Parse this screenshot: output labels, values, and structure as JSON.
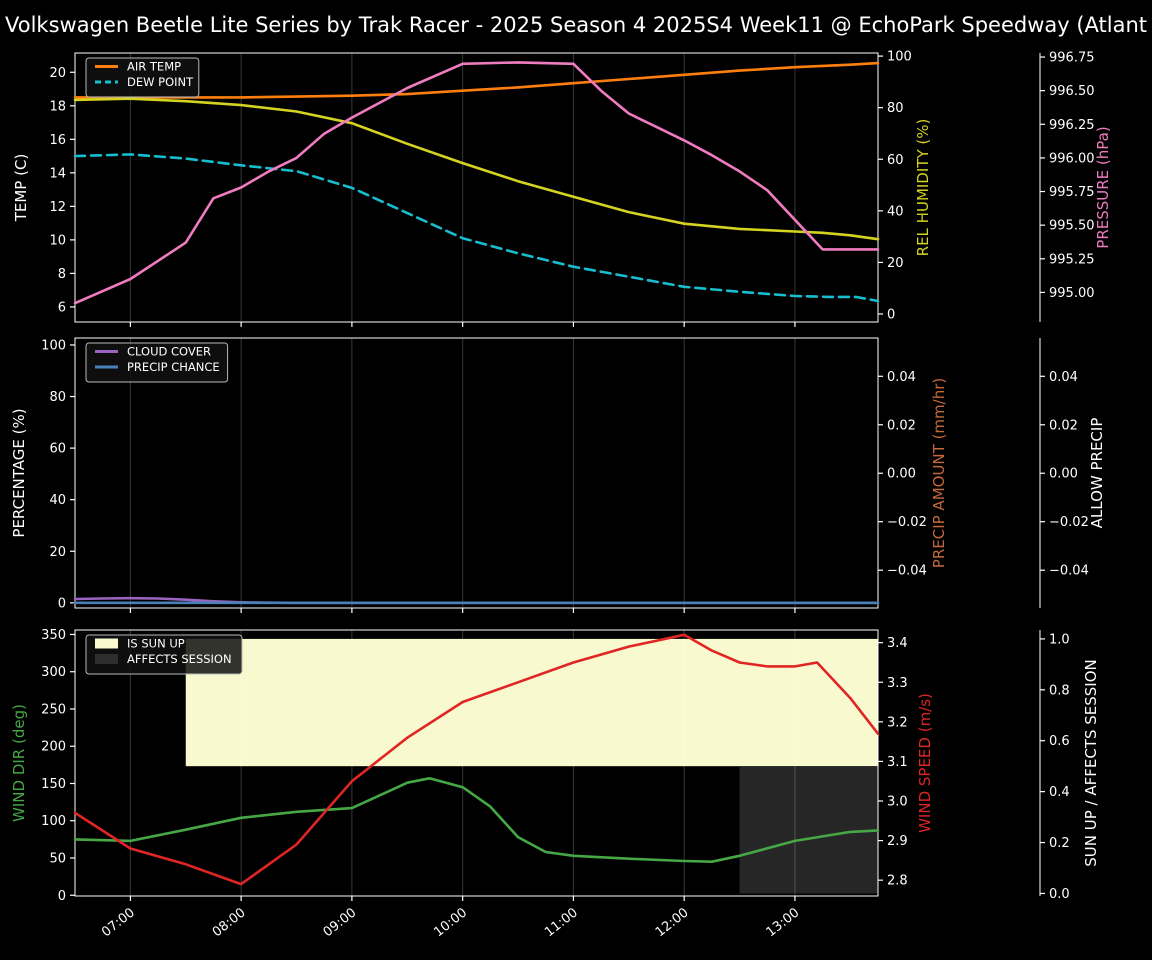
{
  "title": "Volkswagen Beetle Lite Series by Trak Racer - 2025 Season 4 2025S4 Week11 @ EchoPark Speedway (Atlant",
  "colors": {
    "background": "#000000",
    "text": "#ffffff",
    "grid": "rgba(255,255,255,0.22)",
    "air_temp": "#ff7f0e",
    "dew_point": "#17becf",
    "rel_humidity": "#d4d321",
    "pressure": "#ef7bc0",
    "cloud_cover": "#9c63c0",
    "precip_chance": "#4a80b8",
    "precip_amount": "#c4693b",
    "wind_dir": "#46a746",
    "wind_speed": "#e02525",
    "sun_up_fill": "#f9f9cf",
    "affects_session_fill": "#262626"
  },
  "chart_data": [
    {
      "name": "temp-humidity-pressure-chart",
      "type": "line",
      "x_axis": {
        "lim": [
          6.5,
          13.75
        ],
        "tick_values": [
          7,
          8,
          9,
          10,
          11,
          12,
          13
        ],
        "tick_labels": [
          "07:00",
          "08:00",
          "09:00",
          "10:00",
          "11:00",
          "12:00",
          "13:00"
        ],
        "show_labels": false
      },
      "axes": {
        "left": {
          "label": "TEMP (C)",
          "color": "#ffffff",
          "ticks": [
            6,
            8,
            10,
            12,
            14,
            16,
            18,
            20
          ],
          "lim": [
            5.1,
            21.15
          ],
          "decimals": 0
        },
        "right": {
          "label": "REL HUMIDITY (%)",
          "color": "#d4d321",
          "ticks": [
            0,
            20,
            40,
            60,
            80,
            100
          ],
          "lim": [
            -3.1,
            101.2
          ],
          "decimals": 0
        },
        "far": {
          "label": "PRESSURE (hPa)",
          "color": "#ef7bc0",
          "ticks": [
            995.0,
            995.25,
            995.5,
            995.75,
            996.0,
            996.25,
            996.5,
            996.75
          ],
          "lim": [
            994.78,
            996.78
          ],
          "decimals": 2
        }
      },
      "series": [
        {
          "name": "air-temp",
          "label": "AIR TEMP",
          "color": "#ff7f0e",
          "axis": "left",
          "dash": false,
          "x": [
            6.5,
            7,
            7.5,
            8,
            8.5,
            9,
            9.5,
            10,
            10.5,
            11,
            11.5,
            12,
            12.5,
            13,
            13.5,
            13.75
          ],
          "y": [
            18.5,
            18.5,
            18.5,
            18.5,
            18.55,
            18.6,
            18.7,
            18.9,
            19.1,
            19.35,
            19.6,
            19.85,
            20.1,
            20.3,
            20.45,
            20.55
          ]
        },
        {
          "name": "dew-point",
          "label": "DEW POINT",
          "color": "#17becf",
          "axis": "left",
          "dash": true,
          "x": [
            6.5,
            7,
            7.5,
            8,
            8.5,
            9,
            9.5,
            10,
            10.5,
            11,
            11.5,
            12,
            12.5,
            13,
            13.3,
            13.55,
            13.75
          ],
          "y": [
            15.0,
            15.1,
            14.85,
            14.45,
            14.1,
            13.1,
            11.6,
            10.1,
            9.2,
            8.4,
            7.8,
            7.2,
            6.9,
            6.65,
            6.6,
            6.6,
            6.35
          ]
        },
        {
          "name": "rel-humidity",
          "color": "#d4d321",
          "axis": "right",
          "dash": false,
          "x": [
            6.5,
            7,
            7.5,
            8,
            8.5,
            9,
            9.5,
            10,
            10.5,
            11,
            11.5,
            12,
            12.5,
            13,
            13.25,
            13.5,
            13.75
          ],
          "y": [
            83,
            83.5,
            82.5,
            81,
            78.5,
            74,
            66,
            58.5,
            51.5,
            45.5,
            39.5,
            35,
            33,
            32,
            31.5,
            30.5,
            29
          ]
        },
        {
          "name": "pressure",
          "color": "#ef7bc0",
          "axis": "far",
          "dash": false,
          "x": [
            6.5,
            7,
            7.5,
            7.75,
            8,
            8.25,
            8.5,
            8.75,
            9,
            9.5,
            10,
            10.5,
            11,
            11.25,
            11.5,
            12,
            12.25,
            12.5,
            12.75,
            13,
            13.25,
            13.75
          ],
          "y": [
            994.92,
            995.1,
            995.37,
            995.7,
            995.78,
            995.9,
            996.0,
            996.18,
            996.3,
            996.52,
            996.7,
            996.71,
            996.7,
            996.5,
            996.33,
            996.13,
            996.02,
            995.9,
            995.76,
            995.54,
            995.32,
            995.32
          ]
        }
      ],
      "legend": {
        "entries": [
          {
            "label": "AIR TEMP",
            "color": "#ff7f0e",
            "swatch": "line"
          },
          {
            "label": "DEW POINT",
            "color": "#17becf",
            "swatch": "dash"
          }
        ]
      }
    },
    {
      "name": "cloud-precip-chart",
      "type": "line",
      "x_axis": {
        "lim": [
          6.5,
          13.75
        ],
        "tick_values": [
          7,
          8,
          9,
          10,
          11,
          12,
          13
        ],
        "tick_labels": [
          "07:00",
          "08:00",
          "09:00",
          "10:00",
          "11:00",
          "12:00",
          "13:00"
        ],
        "show_labels": false
      },
      "axes": {
        "left": {
          "label": "PERCENTAGE (%)",
          "color": "#ffffff",
          "ticks": [
            0,
            20,
            40,
            60,
            80,
            100
          ],
          "lim": [
            -2,
            102.7
          ],
          "decimals": 0
        },
        "right": {
          "label": "PRECIP AMOUNT (mm/hr)",
          "color": "#c4693b",
          "ticks": [
            0.04,
            0.02,
            0.0,
            -0.02,
            -0.04
          ],
          "lim": [
            -0.0556,
            0.0558
          ],
          "decimals": 2
        },
        "far": {
          "label": "ALLOW PRECIP",
          "color": "#ffffff",
          "ticks": [
            0.04,
            0.02,
            0.0,
            -0.02,
            -0.04
          ],
          "lim": [
            -0.0556,
            0.0558
          ],
          "decimals": 2
        }
      },
      "series": [
        {
          "name": "cloud-cover",
          "label": "CLOUD COVER",
          "color": "#9c63c0",
          "axis": "left",
          "dash": false,
          "x": [
            6.5,
            6.75,
            7,
            7.25,
            7.5,
            7.75,
            8,
            8.25,
            8.5,
            13.75
          ],
          "y": [
            1.5,
            1.7,
            1.8,
            1.7,
            1.2,
            0.6,
            0.2,
            0.05,
            0,
            0
          ]
        },
        {
          "name": "precip-chance",
          "label": "PRECIP CHANCE",
          "color": "#4a80b8",
          "axis": "left",
          "dash": false,
          "x": [
            6.5,
            13.75
          ],
          "y": [
            0,
            0
          ]
        }
      ],
      "legend": {
        "entries": [
          {
            "label": "CLOUD COVER",
            "color": "#9c63c0",
            "swatch": "line"
          },
          {
            "label": "PRECIP CHANCE",
            "color": "#4a80b8",
            "swatch": "line"
          }
        ]
      }
    },
    {
      "name": "wind-sun-chart",
      "type": "line",
      "x_axis": {
        "lim": [
          6.5,
          13.75
        ],
        "tick_values": [
          7,
          8,
          9,
          10,
          11,
          12,
          13
        ],
        "tick_labels": [
          "07:00",
          "08:00",
          "09:00",
          "10:00",
          "11:00",
          "12:00",
          "13:00"
        ],
        "show_labels": true
      },
      "axes": {
        "left": {
          "label": "WIND DIR (deg)",
          "color": "#46a746",
          "ticks": [
            0,
            50,
            100,
            150,
            200,
            250,
            300,
            350
          ],
          "lim": [
            -1,
            356
          ],
          "decimals": 0
        },
        "right": {
          "label": "WIND SPEED (m/s)",
          "color": "#e02525",
          "ticks": [
            2.8,
            2.9,
            3.0,
            3.1,
            3.2,
            3.3,
            3.4
          ],
          "lim": [
            2.76,
            3.432
          ],
          "decimals": 1
        },
        "far": {
          "label": "SUN UP / AFFECTS SESSION",
          "color": "#ffffff",
          "ticks": [
            0.0,
            0.2,
            0.4,
            0.6,
            0.8,
            1.0
          ],
          "lim": [
            -0.01,
            1.035
          ],
          "decimals": 1
        }
      },
      "regions": [
        {
          "name": "is-sun-up",
          "color": "#f9f9cf",
          "axis": "far",
          "x": [
            7.5,
            13.75
          ],
          "y": [
            0.5,
            1.0
          ]
        },
        {
          "name": "affects-session",
          "color": "#262626",
          "axis": "far",
          "x": [
            12.5,
            13.75
          ],
          "y": [
            0.0,
            0.5
          ]
        }
      ],
      "series": [
        {
          "name": "wind-dir",
          "color": "#46a746",
          "axis": "left",
          "dash": false,
          "x": [
            6.5,
            7,
            7.5,
            8,
            8.5,
            9,
            9.5,
            9.7,
            10,
            10.25,
            10.5,
            10.75,
            11,
            11.5,
            12,
            12.25,
            12.5,
            13,
            13.5,
            13.75
          ],
          "y": [
            75,
            73,
            88,
            104,
            112,
            117,
            151,
            157,
            145,
            119,
            78,
            58,
            53,
            49,
            46,
            45,
            53,
            73,
            85,
            87
          ]
        },
        {
          "name": "wind-speed",
          "color": "#e02525",
          "axis": "right",
          "dash": false,
          "x": [
            6.5,
            7,
            7.5,
            8,
            8.5,
            9,
            9.5,
            10,
            10.5,
            11,
            11.5,
            12,
            12.25,
            12.5,
            12.75,
            13,
            13.2,
            13.5,
            13.75
          ],
          "y": [
            2.97,
            2.88,
            2.84,
            2.79,
            2.89,
            3.05,
            3.16,
            3.25,
            3.3,
            3.35,
            3.39,
            3.42,
            3.38,
            3.35,
            3.34,
            3.34,
            3.35,
            3.26,
            3.17
          ]
        }
      ],
      "legend": {
        "entries": [
          {
            "label": "IS SUN UP",
            "color": "#f9f9cf",
            "swatch": "patch"
          },
          {
            "label": "AFFECTS SESSION",
            "color": "#2e2e2e",
            "swatch": "patch"
          }
        ]
      }
    }
  ]
}
